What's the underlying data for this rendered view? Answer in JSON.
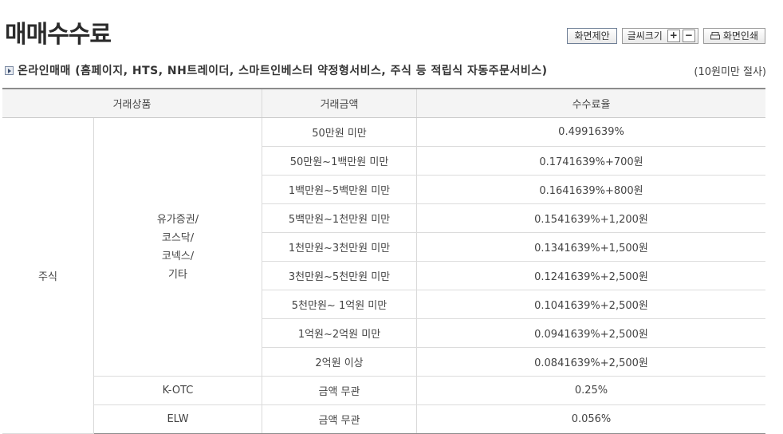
{
  "page": {
    "title": "매매수수료"
  },
  "toolbar": {
    "suggest_label": "화면제안",
    "font_size_label": "글씨크기",
    "increase_label": "+",
    "decrease_label": "−",
    "print_label": "화면인쇄"
  },
  "section": {
    "title": "온라인매매 (홈페이지, HTS, NH트레이더, 스마트인베스터 약정형서비스, 주식 등 적립식 자동주문서비스)",
    "note": "(10원미만 절사)"
  },
  "table": {
    "headers": [
      "거래상품",
      "거래금액",
      "수수료율"
    ],
    "category": "주식",
    "subcategory_lines": [
      "유가증권/",
      "코스닥/",
      "코넥스/",
      "기타"
    ],
    "rows": [
      {
        "amount": "50만원 미만",
        "rate": "0.4991639%"
      },
      {
        "amount": "50만원~1백만원 미만",
        "rate": "0.1741639%+700원"
      },
      {
        "amount": "1백만원~5백만원 미만",
        "rate": "0.1641639%+800원"
      },
      {
        "amount": "5백만원~1천만원 미만",
        "rate": "0.1541639%+1,200원"
      },
      {
        "amount": "1천만원~3천만원 미만",
        "rate": "0.1341639%+1,500원"
      },
      {
        "amount": "3천만원~5천만원 미만",
        "rate": "0.1241639%+2,500원"
      },
      {
        "amount": "5천만원~ 1억원 미만",
        "rate": "0.1041639%+2,500원"
      },
      {
        "amount": "1억원~2억원 미만",
        "rate": "0.0941639%+2,500원"
      },
      {
        "amount": "2억원 이상",
        "rate": "0.0841639%+2,500원"
      }
    ],
    "kotc": {
      "product": "K-OTC",
      "amount": "금액 무관",
      "rate": "0.25%"
    },
    "elw": {
      "product": "ELW",
      "amount": "금액 무관",
      "rate": "0.056%"
    }
  }
}
